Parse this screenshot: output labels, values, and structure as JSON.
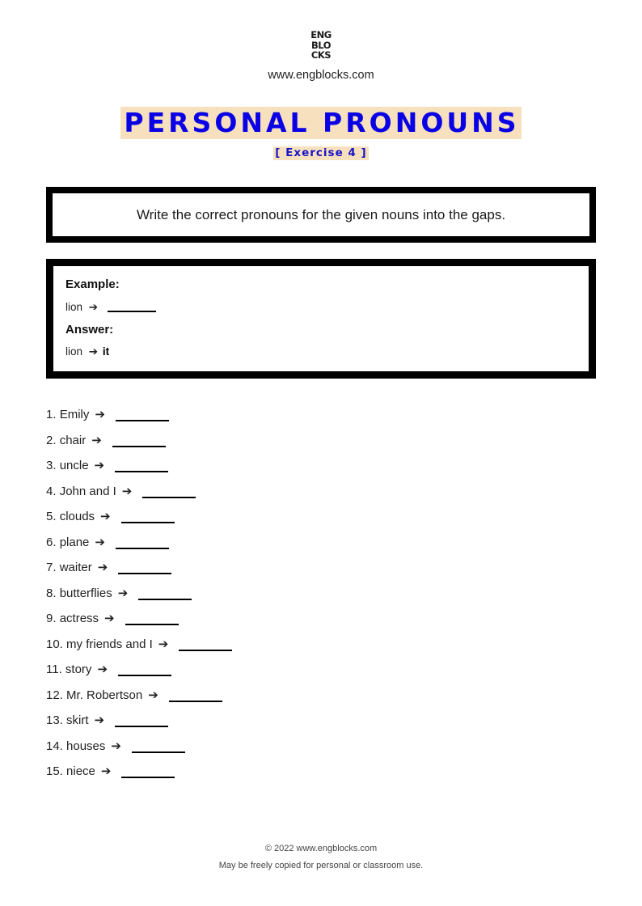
{
  "header": {
    "logo_lines": [
      "ENG",
      "BLO",
      "CKS"
    ],
    "website": "www.engblocks.com"
  },
  "title": "PERSONAL PRONOUNS",
  "subtitle": "[ Exercise 4 ]",
  "instruction": "Write the correct pronouns for the given nouns into the gaps.",
  "example": {
    "example_label": "Example:",
    "example_noun": "lion",
    "answer_label": "Answer:",
    "answer_noun": "lion",
    "answer_value": "it",
    "arrow": "➔"
  },
  "arrow": "➔",
  "items": [
    {
      "num": "1.",
      "noun": "Emily"
    },
    {
      "num": "2.",
      "noun": "chair"
    },
    {
      "num": "3.",
      "noun": "uncle"
    },
    {
      "num": "4.",
      "noun": "John and I"
    },
    {
      "num": "5.",
      "noun": "clouds"
    },
    {
      "num": "6.",
      "noun": "plane"
    },
    {
      "num": "7.",
      "noun": "waiter"
    },
    {
      "num": "8.",
      "noun": "butterflies"
    },
    {
      "num": "9.",
      "noun": "actress"
    },
    {
      "num": "10.",
      "noun": "my friends and I"
    },
    {
      "num": "11.",
      "noun": "story"
    },
    {
      "num": "12.",
      "noun": "Mr. Robertson"
    },
    {
      "num": "13.",
      "noun": "skirt"
    },
    {
      "num": "14.",
      "noun": "houses"
    },
    {
      "num": "15.",
      "noun": "niece"
    }
  ],
  "footer": {
    "copyright": "© 2022 www.engblocks.com",
    "license": "May be freely copied for personal or classroom use."
  },
  "colors": {
    "title_text": "#0a00e6",
    "title_highlight": "#f6e0bd",
    "border": "#000000"
  }
}
